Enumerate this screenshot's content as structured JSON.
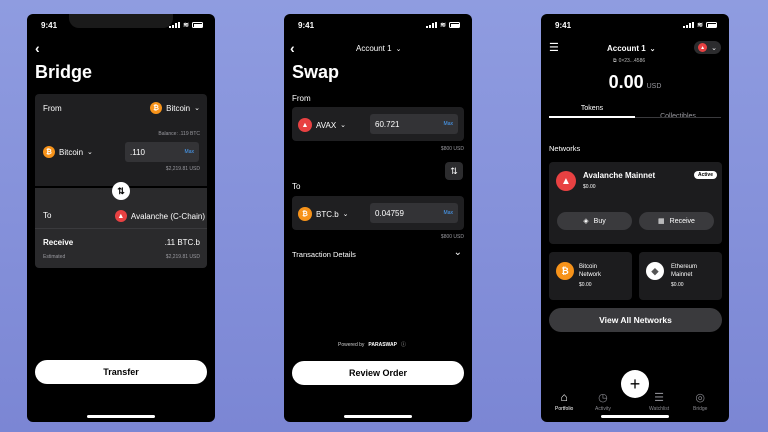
{
  "status": {
    "time": "9:41"
  },
  "bridge": {
    "title": "Bridge",
    "from_label": "From",
    "from_token": "Bitcoin",
    "balance": "Balance: .119 BTC",
    "asset": "Bitcoin",
    "amount": ".110",
    "max": "Max",
    "usd": "$2,219.81 USD",
    "to_label": "To",
    "to_chain": "Avalanche (C-Chain)",
    "receive_label": "Receive",
    "receive_value": ".11 BTC.b",
    "estimated_label": "Estimated",
    "estimated_usd": "$2,219.81 USD",
    "transfer_button": "Transfer"
  },
  "swap": {
    "account": "Account 1",
    "title": "Swap",
    "from_label": "From",
    "from_token": "AVAX",
    "from_amount": "60.721",
    "max": "Max",
    "from_usd": "$800 USD",
    "to_label": "To",
    "to_token": "BTC.b",
    "to_amount": "0.04759",
    "to_usd": "$800 USD",
    "details_label": "Transaction Details",
    "powered_by": "Powered by",
    "provider": "PARASWAP",
    "review_button": "Review Order"
  },
  "portfolio": {
    "account": "Account 1",
    "address": "0×23...4586",
    "balance": "0.00",
    "currency": "USD",
    "tabs": [
      "Tokens",
      "Collectibles"
    ],
    "networks_label": "Networks",
    "main_network": {
      "name": "Avalanche Mainnet",
      "value": "$0.00",
      "badge": "Active"
    },
    "buy": "Buy",
    "receive": "Receive",
    "networks": [
      {
        "name1": "Bitcoin",
        "name2": "Network",
        "value": "$0.00"
      },
      {
        "name1": "Ethereum",
        "name2": "Mainnet",
        "value": "$0.00"
      }
    ],
    "view_all": "View All Networks",
    "nav": [
      "Portfolio",
      "Activity",
      "Watchlist",
      "Bridge"
    ]
  },
  "colors": {
    "accent_blue": "#4aa3ff",
    "btc": "#f7931a",
    "avax": "#e84142"
  }
}
